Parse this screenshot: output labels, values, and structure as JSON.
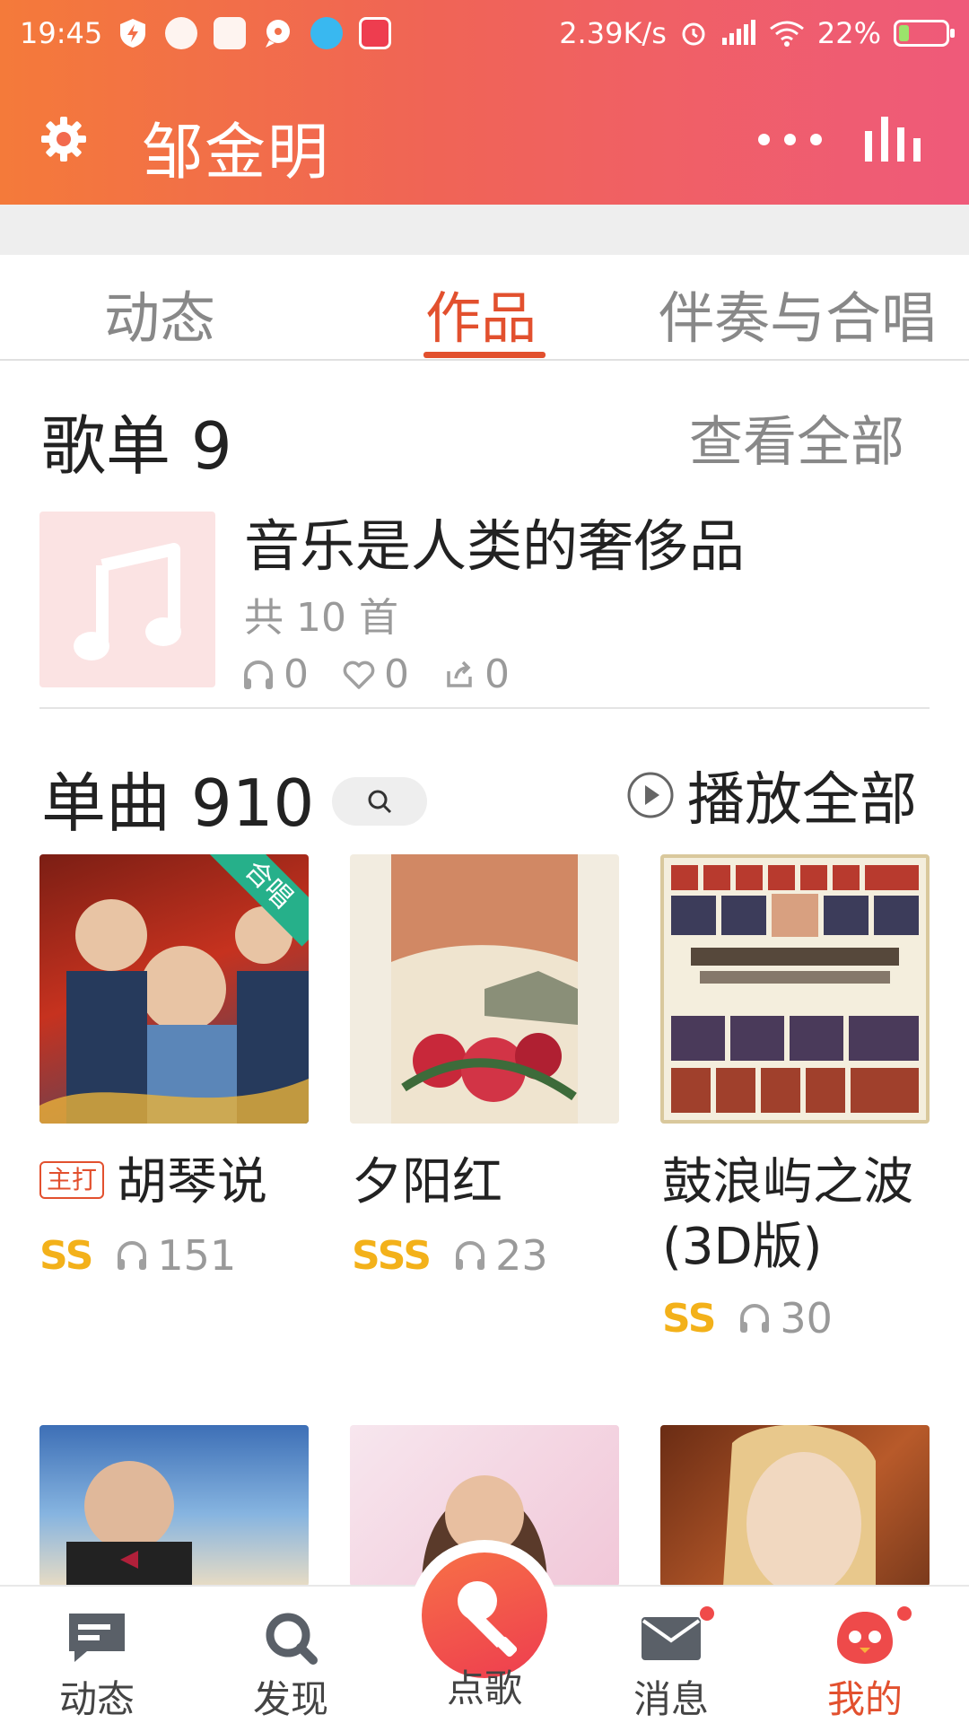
{
  "status_bar": {
    "time": "19:45",
    "net_speed": "2.39K/s",
    "battery_percent": "22%",
    "battery_level": 0.22,
    "icons": [
      "shield-icon",
      "app-icon",
      "mi-icon",
      "chat-icon",
      "bird-icon",
      "game-icon",
      "alarm-icon",
      "signal-icon",
      "wifi-icon",
      "battery-icon"
    ]
  },
  "header": {
    "title": "邹金明",
    "accent_start": "#f47a3a",
    "accent_end": "#ef5a7a",
    "icons": [
      "gear-icon",
      "more-icon",
      "equalizer-icon"
    ]
  },
  "tabs": [
    {
      "label": "动态",
      "active": false
    },
    {
      "label": "作品",
      "active": true
    },
    {
      "label": "伴奏与合唱",
      "active": false
    }
  ],
  "playlists": {
    "title": "歌单 9",
    "view_all": "查看全部",
    "item": {
      "name": "音乐是人类的奢侈品",
      "count": "共 10 首",
      "listens": "0",
      "likes": "0",
      "shares": "0"
    }
  },
  "singles": {
    "title": "单曲 910",
    "play_all": "播放全部",
    "songs": [
      {
        "title": "胡琴说",
        "tag": "主打",
        "grade": "SS",
        "plays": "151",
        "badge": "合唱"
      },
      {
        "title": "夕阳红",
        "grade": "SSS",
        "plays": "23"
      },
      {
        "title": "鼓浪屿之波",
        "title2": "(3D版)",
        "grade": "SS",
        "plays": "30"
      }
    ]
  },
  "bottom_nav": {
    "items": [
      {
        "label": "动态",
        "icon": "feed-icon"
      },
      {
        "label": "发现",
        "icon": "search-icon"
      },
      {
        "label": "点歌",
        "icon": "microphone-icon"
      },
      {
        "label": "消息",
        "icon": "mail-icon"
      },
      {
        "label": "我的",
        "icon": "profile-icon"
      }
    ],
    "active_color": "#e2502e"
  }
}
